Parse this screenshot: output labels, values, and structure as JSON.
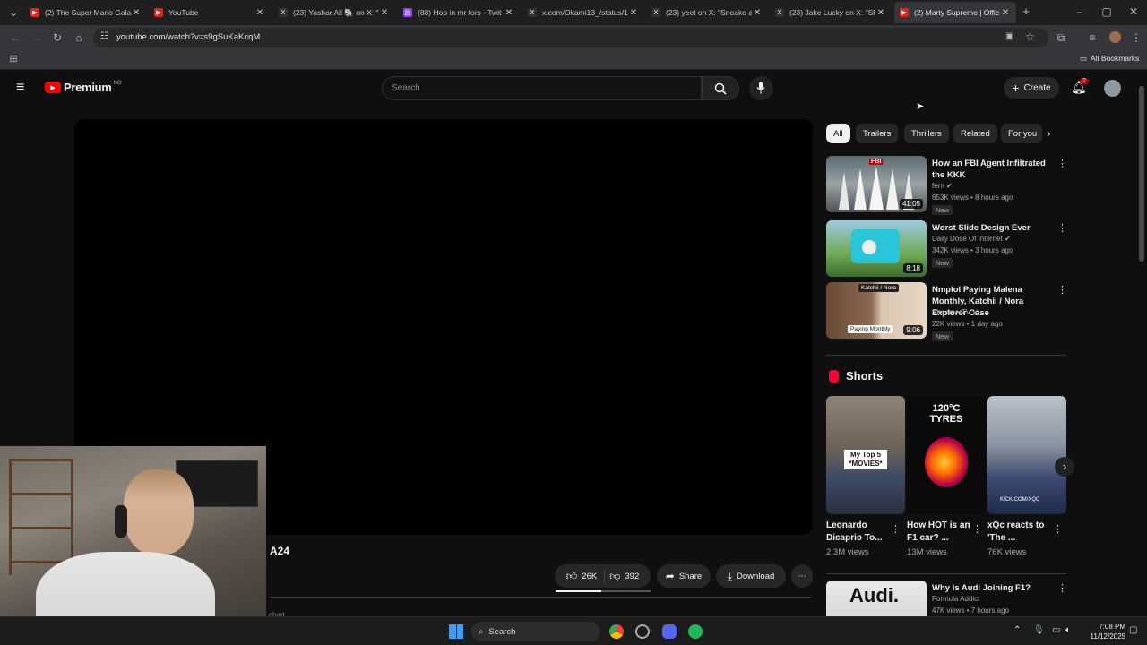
{
  "browser": {
    "tabs": [
      {
        "title": "(2) The Super Mario Gala",
        "favicon_color": "#e62117"
      },
      {
        "title": "YouTube",
        "favicon_color": "#e62117"
      },
      {
        "title": "(23) Yashar Ali 🐘 on X: \"",
        "favicon_color": "#333333"
      },
      {
        "title": "(88) Hop in mr fors - Twit",
        "favicon_color": "#9146ff"
      },
      {
        "title": "x.com/Okami13_/status/1",
        "favicon_color": "#333333"
      },
      {
        "title": "(23) yeet on X: \"Sneako a",
        "favicon_color": "#333333"
      },
      {
        "title": "(23) Jake Lucky on X: \"Sh",
        "favicon_color": "#333333"
      },
      {
        "title": "(2) Marty Supreme | Offic",
        "favicon_color": "#e62117"
      }
    ],
    "new_tab": "+",
    "url": "youtube.com/watch?v=s9gSuKaKcqM",
    "bookmarks_label": "All Bookmarks"
  },
  "youtube": {
    "logo_text": "Premium",
    "logo_region": "NO",
    "search_placeholder": "Search",
    "create_label": "Create",
    "notif_count": "2",
    "chips": [
      "All",
      "Trailers",
      "Thrillers",
      "Related",
      "For you"
    ],
    "channel_name": "A24",
    "likes": "26K",
    "dislikes": "392",
    "share_label": "Share",
    "download_label": "Download",
    "below_fold_text": "chart",
    "recommendations": [
      {
        "title": "How an FBI Agent Infiltrated the KKK",
        "channel": "fern",
        "meta": "653K views • 8 hours ago",
        "badge": "New",
        "duration": "41:05"
      },
      {
        "title": "Worst Slide Design Ever",
        "channel": "Daily Dose Of Internet",
        "meta": "342K views • 3 hours ago",
        "badge": "New",
        "duration": "8:18"
      },
      {
        "title": "Nmplol Paying Malena Monthly, Katchii / Nora Explorer Case",
        "channel": "StreamerTV",
        "meta": "22K views • 1 day ago",
        "badge": "New",
        "duration": "9:06"
      },
      {
        "title": "Why is Audi Joining F1?",
        "channel": "Formula Addict",
        "meta": "47K views • 7 hours ago"
      }
    ],
    "shorts_heading": "Shorts",
    "shorts": [
      {
        "title": "Leonardo Dicaprio To...",
        "views": "2.3M views",
        "overlay": "My Top 5 *MOVIES*"
      },
      {
        "title": "How HOT is an F1 car? ...",
        "views": "13M views",
        "overlay": "120°C TYRES"
      },
      {
        "title": "xQc reacts to 'The ...",
        "views": "76K views",
        "overlay": "KICK.COM/XQC"
      }
    ],
    "thumb_text": {
      "kkk": "FBI",
      "katchii": "Katchii / Nora",
      "paying": "Paying Monthly",
      "audi": "Audi."
    }
  },
  "taskbar": {
    "search_label": "Search",
    "time": "7:08 PM",
    "date": "11/12/2025"
  }
}
